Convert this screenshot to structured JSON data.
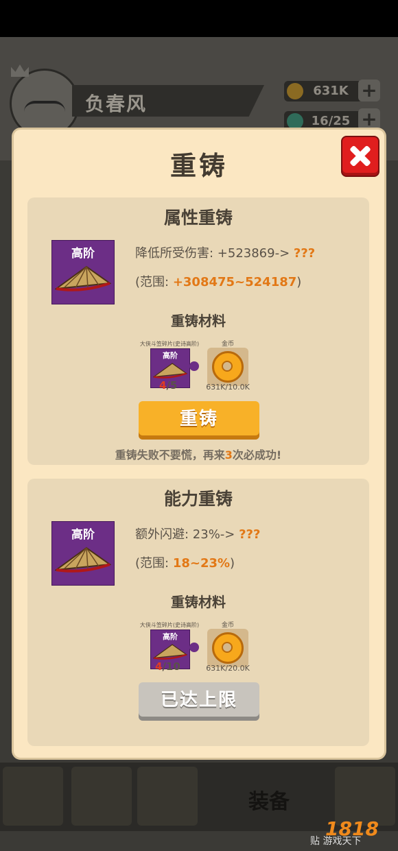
{
  "player": {
    "name": "负春风"
  },
  "resources": {
    "gold": "631K",
    "energy": "16/25"
  },
  "bottom_nav": {
    "equip_label": "装备"
  },
  "watermark": {
    "brand": "1818",
    "sub": "贴 游戏天下"
  },
  "modal": {
    "title": "重铸",
    "attribute_section": {
      "title": "属性重铸",
      "item_tier": "高阶",
      "stat_label": "降低所受伤害: +523869->",
      "stat_unknown": "???",
      "range_prefix": "(范围: ",
      "range_value": "+308475~524187",
      "range_suffix": ")",
      "materials_title": "重铸材料",
      "material_name": "大侠斗笠碎片(史诗高阶)",
      "material_tier": "高阶",
      "material_have": "4",
      "material_need": "/5",
      "coin_name": "金币",
      "coin_count": "631K/10.0K",
      "button": "重铸",
      "tip_prefix": "重铸失败不要慌，再来",
      "tip_number": "3",
      "tip_suffix": "次必成功!"
    },
    "ability_section": {
      "title": "能力重铸",
      "item_tier": "高阶",
      "stat_label": "额外闪避: 23%->",
      "stat_unknown": "???",
      "range_prefix": "(范围: ",
      "range_value": "18~23%",
      "range_suffix": ")",
      "materials_title": "重铸材料",
      "material_name": "大侠斗笠碎片(史诗高阶)",
      "material_tier": "高阶",
      "material_have": "4",
      "material_need": "/10",
      "coin_name": "金币",
      "coin_count": "631K/20.0K",
      "button": "已达上限"
    }
  },
  "colors": {
    "accent": "#e27816",
    "button_primary": "#f8b128",
    "button_disabled": "#c8c4bd",
    "close": "#e01e1e",
    "item_bg": "#6c2e86"
  }
}
